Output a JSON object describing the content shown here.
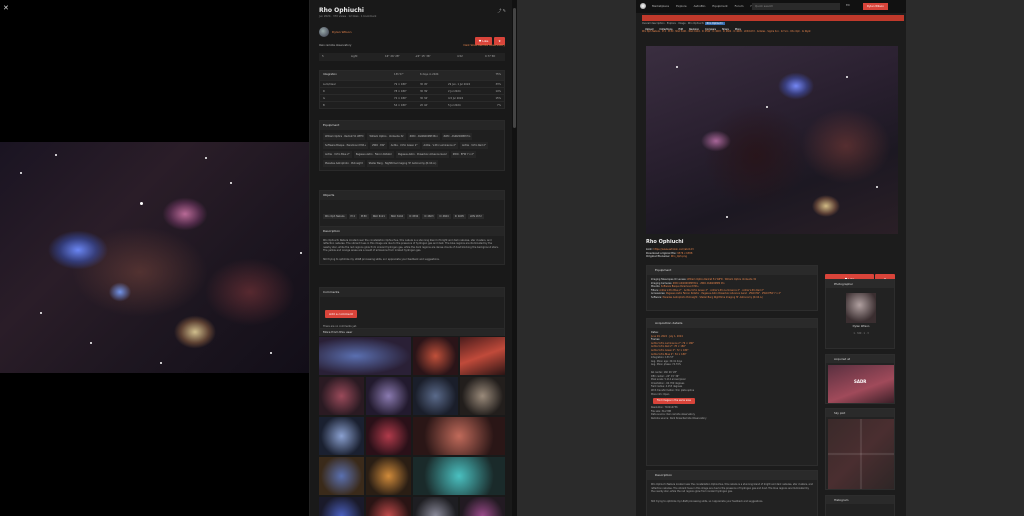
{
  "viewer": {
    "close_label": "✕"
  },
  "detail": {
    "title": "Rho Ophiuchi",
    "meta": "Jun 2024 · 370 views · 12 likes · 1 bookmark",
    "photographer": "Dylan Wilson",
    "like_label": "Like",
    "bookmark_label": "★",
    "obs_left": "Own remote observatory",
    "obs_right": "Dark Skies Remote Observatory",
    "obs_vals": [
      "5",
      "Light",
      "16° 26' 28\"",
      "-24° 15' 36\"",
      "4.52",
      "0.77 5D"
    ],
    "integration_title": "Integration",
    "integration_total": "13h 57'",
    "integration_nights": "6 days in 2024",
    "integration_pct": "75%",
    "integration_rows": [
      {
        "filter": "Lum/Clear",
        "subs": "79 × 180\"",
        "time": "3h 45'",
        "date": "29 Jun, 1 Jul 2024",
        "pct": "33%"
      },
      {
        "filter": "R",
        "subs": "78 × 180\"",
        "time": "3h 39'",
        "date": "2 Jul 2024",
        "pct": "14%"
      },
      {
        "filter": "G",
        "subs": "72 × 180\"",
        "time": "3h 34'",
        "date": "4-5 Jul 2024",
        "pct": "15%"
      },
      {
        "filter": "B",
        "subs": "54 × 180\"",
        "time": "2h 42'",
        "date": "5 Jul 2024",
        "pct": "7%"
      }
    ],
    "equipment_title": "Equipment",
    "equipment": [
      "William Optics · Redcat 51 WIFD",
      "William Optics · UniGuide 32",
      "ZWO · ASI2600MM Mini",
      "ZWO · ASI6200MM Pro",
      "Software Bisque · Paramount MX+",
      "ZWO · EAF",
      "Antlia · V-Pro Green 2\"",
      "Antlia · V-Pro Luminance 2\"",
      "Antlia · V-Pro Red 2\"",
      "Antlia · V-Pro Blue 2\"",
      "Pegasus Astro · Falcon Rotator",
      "Pegasus Astro · Powerbox Advance Gen2",
      "ZWO · EFW 7 x 2\"",
      "Pleiades Astrophoto · PixInsight",
      "Stellar Berg · Nighttime Imaging 'N' Astronomy (N.I.N.A.)"
    ],
    "objects_title": "Objects",
    "objects": [
      "Rho Oph Nebula",
      "M 4",
      "M 80",
      "NGC 6121",
      "NGC 6144",
      "IC 4592",
      "IC 4603",
      "IC 4604",
      "IC 4605",
      "LDN 1672",
      "+ 47 more"
    ],
    "description_title": "Description",
    "description": "Rho Ophiuchi Nebula located near the constellation Ophiuchus, this nebula is a stunning blend of bright and dark nebulae, star clusters, and reflection nebulae. The vibrant hues in this image are due to the presence of hydrogen gas and dust. The blue regions are illuminated by the nearby star, while the red regions glow from ionized hydrogen gas, while the dark regions are dense clouds of dust blocking the background stars. The yellow and orange areas are a result of emissions from ionized hydrogen gas.",
    "description_2": "Still trying to optimize my LRGB processing skills, so I appreciate your feedback and suggestions.",
    "comments_title": "Comments",
    "add_comment": "Add a comment",
    "no_comments": "There are no comments yet.",
    "more_title": "More from this user"
  },
  "site": {
    "nav": [
      "Marketplace",
      "Explore",
      "AstroBin",
      "Equipment",
      "Forum",
      "Help"
    ],
    "search_placeholder": "Quick search",
    "lang": "EN",
    "user_button": "Dylan Wilson",
    "subnav": [
      "Upload",
      "Collections",
      "Edit",
      "Revision",
      "Compare",
      "Share",
      "More"
    ],
    "crumbs": "Overall description · Explore · Image · Rho Ophiuchi",
    "tab_active": "Rho Ophiuchi",
    "tags": "Rho Oph Nebula · M 4 · M 80 · NGC 6121 · NGC 6144 · IC 4592 · IC 4603 · IC 4604 · IC 4605 · LDN 1672 · Antares · Sigma Sco · 22 Sco · Rho Oph · Al Niyat",
    "title": "Rho Ophiuchi",
    "meta_link_label": "Link:",
    "meta_link": "https://www.astrobin.com/abc123",
    "meta_orig_label": "Download original file:",
    "meta_orig": "9576 x 6388",
    "meta_filename_label": "Original filename:",
    "meta_filename": "Rho_Oph.png",
    "like_label": "Like",
    "equipment_title": "Equipment",
    "equipment_lines": [
      {
        "k": "Imaging Telescopes Or Lenses:",
        "v": "William Optics Redcat 51 WIFD · William Optics UniGuide 32"
      },
      {
        "k": "Imaging Cameras:",
        "v": "ZWO ASI2600MM Mini · ZWO ASI6200MM Pro"
      },
      {
        "k": "Mounts:",
        "v": "Software Bisque Paramount MX+"
      },
      {
        "k": "Filters:",
        "v": "Antlia V-Pro Blue 2\" · Antlia V-Pro Green 2\" · Antlia V-Pro Luminance 2\" · Antlia V-Pro Red 2\""
      },
      {
        "k": "Accessories:",
        "v": "Pegasus Astro Falcon Rotator · Pegasus Astro Powerbox Advance Gen2 · ZWO EAF · ZWO EFW 7 x 2\""
      },
      {
        "k": "Software:",
        "v": "Pleiades Astrophoto PixInsight · Stellar Berg Nighttime Imaging 'N' Astronomy (N.I.N.A.)"
      }
    ],
    "acq_title": "Acquisition details",
    "acq_dates_label": "Dates:",
    "acq_dates": "June 29, 2024 · July 1, 2024",
    "acq_frames_label": "Frames:",
    "acq_frames": [
      "Antlia V-Pro Luminance 2\": 79 × 180\"",
      "Antlia V-Pro Red 2\": 78 × 180\"",
      "Antlia V-Pro Green 2\": 72 × 180\"",
      "Antlia V-Pro Blue 2\": 54 × 180\""
    ],
    "acq_integration": "Integration: 13h 57'",
    "acq_moon_age": "Avg. Moon age: 20.41 days",
    "acq_moon_phase": "Avg. Moon phase: 74.79%",
    "astro": [
      "RA center: 16h 26' 28\"",
      "DEC center: -24° 15' 36\"",
      "Pixel scale: 5.112 arcsec/pixel",
      "Orientation: -92.709 degrees",
      "Field radius: 4.153 degrees",
      "WCS transformation: thin plate spline",
      "More info: Open"
    ],
    "find_button": "Find images in the same area",
    "res_lines": [
      "Resolution: 7102x4736",
      "File size: 34.2 MB",
      "Data source: Own remote observatory",
      "Remote source: Dark Skies Remote Observatory"
    ],
    "desc_title": "Description",
    "desc_text": "Rho Ophiuchi Nebula located near the constellation Ophiuchus, this nebula is a stunning blend of bright and dark nebulae, star clusters, and reflection nebulae. The vibrant hues in this image are due to the presence of hydrogen gas and dust. The blue regions are illuminated by the nearby star, while the red regions glow from ionized hydrogen gas.",
    "desc_more": "Still trying to optimize my LRGB processing skills, so I appreciate your feedback and suggestions.",
    "side_photographer": "Photographer",
    "side_photographer_name": "Dylan Wilson",
    "side_stats": "1 · 320 · 1 · 3",
    "side_acquired": "Acquired at",
    "side_skyplot": "Sky plot",
    "side_histogram": "Histogram",
    "obs_logo_text": "SADR"
  },
  "colors": {
    "accent": "#e8854c",
    "brand_red": "#d9443a",
    "tab_blue": "#3a6fb0"
  }
}
